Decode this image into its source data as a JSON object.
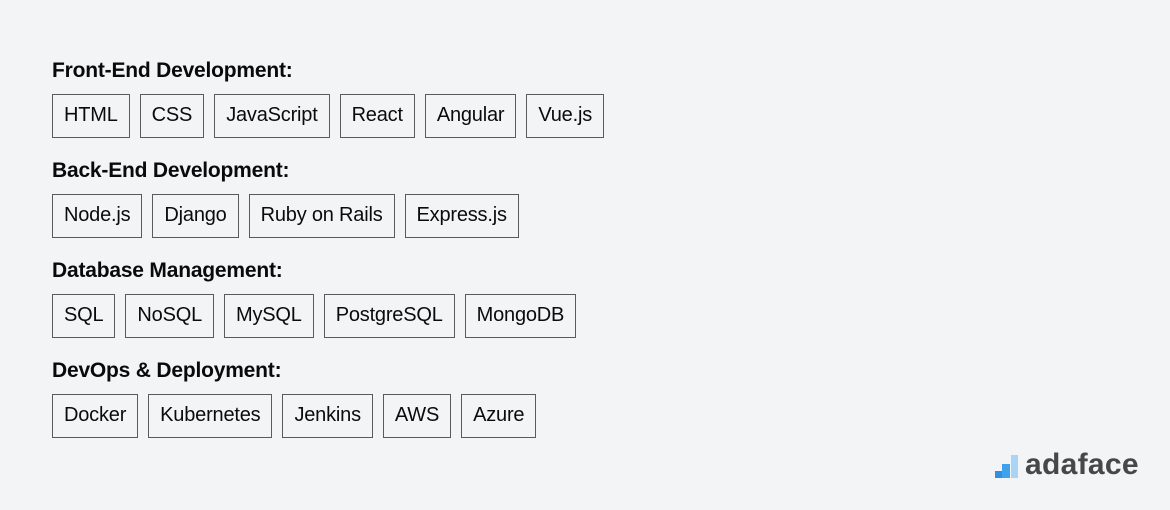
{
  "sections": [
    {
      "title": "Front-End Development:",
      "skills": [
        "HTML",
        "CSS",
        "JavaScript",
        "React",
        "Angular",
        "Vue.js"
      ]
    },
    {
      "title": "Back-End Development:",
      "skills": [
        "Node.js",
        "Django",
        "Ruby on Rails",
        "Express.js"
      ]
    },
    {
      "title": "Database Management:",
      "skills": [
        "SQL",
        "NoSQL",
        "MySQL",
        "PostgreSQL",
        "MongoDB"
      ]
    },
    {
      "title": "DevOps & Deployment:",
      "skills": [
        "Docker",
        "Kubernetes",
        "Jenkins",
        "AWS",
        "Azure"
      ]
    }
  ],
  "brand": {
    "name": "adaface",
    "icon": "ascending-bars-logo-icon",
    "colors": {
      "bar_dark": "#2f8fe0",
      "bar_mid": "#3fa0ec",
      "bar_light": "#a9d4f5",
      "text": "#474747"
    }
  },
  "colors": {
    "background": "#f3f4f6",
    "chip_border": "#5a5a5a",
    "text": "#0b0b0b"
  }
}
